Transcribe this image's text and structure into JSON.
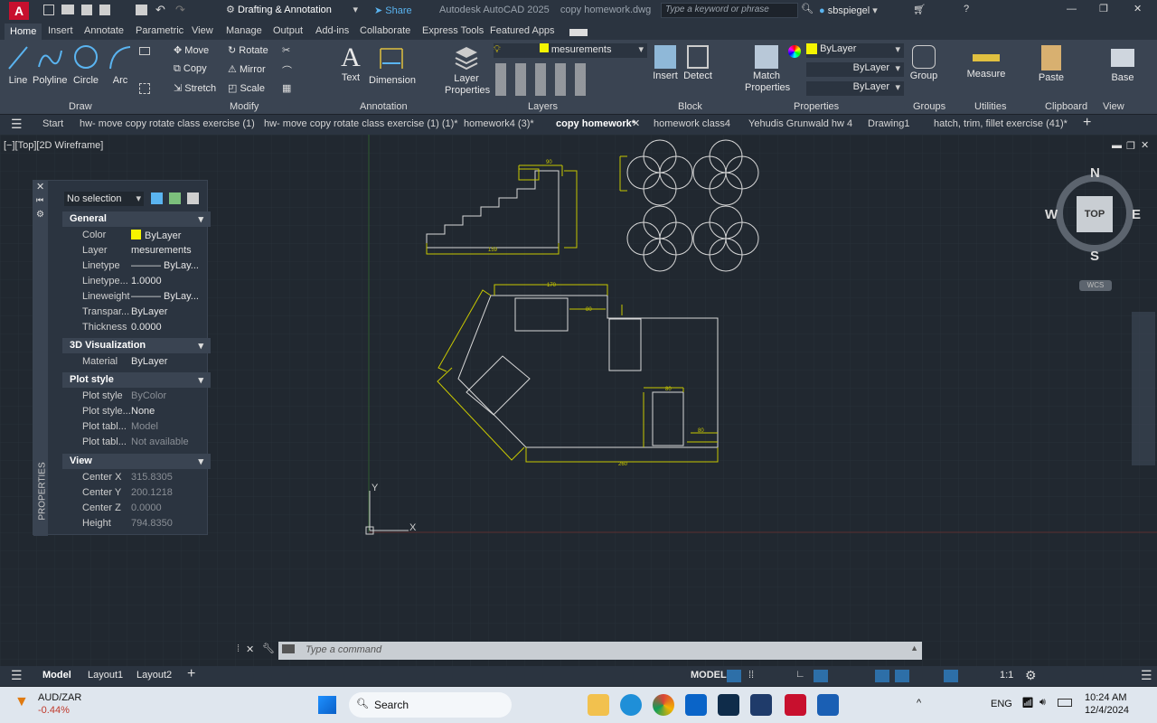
{
  "titlebar": {
    "workspace": "Drafting & Annotation",
    "share": "Share",
    "app_title": "Autodesk AutoCAD 2025    copy homework.dwg",
    "search_placeholder": "Type a keyword or phrase",
    "user": "sbspiegel"
  },
  "ribbon_tabs": [
    "Home",
    "Insert",
    "Annotate",
    "Parametric",
    "View",
    "Manage",
    "Output",
    "Add-ins",
    "Collaborate",
    "Express Tools",
    "Featured Apps"
  ],
  "ribbon": {
    "draw": {
      "line": "Line",
      "polyline": "Polyline",
      "circle": "Circle",
      "arc": "Arc",
      "title": "Draw"
    },
    "modify": {
      "move": "Move",
      "rotate": "Rotate",
      "copy": "Copy",
      "mirror": "Mirror",
      "stretch": "Stretch",
      "scale": "Scale",
      "title": "Modify"
    },
    "annotation": {
      "text": "Text",
      "dimension": "Dimension",
      "title": "Annotation"
    },
    "layers": {
      "layer_properties": "Layer Properties",
      "current_layer": "mesurements",
      "title": "Layers"
    },
    "block": {
      "insert": "Insert",
      "detect": "Detect",
      "title": "Block"
    },
    "properties": {
      "match": "Match Properties",
      "color": "ByLayer",
      "linetype": "ByLayer",
      "lineweight": "ByLayer",
      "title": "Properties"
    },
    "groups": {
      "group": "Group",
      "title": "Groups"
    },
    "utilities": {
      "measure": "Measure",
      "title": "Utilities"
    },
    "clipboard": {
      "paste": "Paste",
      "title": "Clipboard"
    },
    "view": {
      "base": "Base",
      "title": "View"
    }
  },
  "doc_tabs": [
    "Start",
    "hw- move copy rotate class exercise (1)",
    "hw- move copy rotate class exercise (1) (1)*",
    "homework4 (3)*",
    "copy homework*",
    "homework class4",
    "Yehudis Grunwald hw 4",
    "Drawing1",
    "hatch, trim, fillet exercise (41)*"
  ],
  "viewport_label": "[−][Top][2D Wireframe]",
  "properties_panel": {
    "selection": "No selection",
    "side_label": "PROPERTIES",
    "general_title": "General",
    "general": [
      {
        "k": "Color",
        "v": "ByLayer"
      },
      {
        "k": "Layer",
        "v": "mesurements"
      },
      {
        "k": "Linetype",
        "v": "——— ByLay..."
      },
      {
        "k": "Linetype...",
        "v": "1.0000"
      },
      {
        "k": "Lineweight",
        "v": "——— ByLay..."
      },
      {
        "k": "Transpar...",
        "v": "ByLayer"
      },
      {
        "k": "Thickness",
        "v": "0.0000"
      }
    ],
    "viz_title": "3D Visualization",
    "viz": [
      {
        "k": "Material",
        "v": "ByLayer"
      }
    ],
    "plot_title": "Plot style",
    "plot": [
      {
        "k": "Plot style",
        "v": "ByColor"
      },
      {
        "k": "Plot style...",
        "v": "None"
      },
      {
        "k": "Plot tabl...",
        "v": "Model"
      },
      {
        "k": "Plot tabl...",
        "v": "Not available"
      }
    ],
    "view_title": "View",
    "view": [
      {
        "k": "Center X",
        "v": "315.8305"
      },
      {
        "k": "Center Y",
        "v": "200.1218"
      },
      {
        "k": "Center Z",
        "v": "0.0000"
      },
      {
        "k": "Height",
        "v": "794.8350"
      }
    ]
  },
  "viewcube": {
    "n": "N",
    "s": "S",
    "e": "E",
    "w": "W",
    "top": "TOP",
    "wcs": "WCS"
  },
  "ucs": {
    "x": "X",
    "y": "Y"
  },
  "dims": {
    "stair_top": "90",
    "stair_bottom": "159",
    "room_top": "170",
    "room_bottom": "260",
    "room_inner": "80",
    "room_right": "80",
    "room_inner2": "80"
  },
  "command": {
    "placeholder": "Type a command"
  },
  "status": {
    "model_tab": "Model",
    "layout1": "Layout1",
    "layout2": "Layout2",
    "model_btn": "MODEL",
    "scale": "1:1"
  },
  "taskbar": {
    "ticker": "AUD/ZAR",
    "change": "-0.44%",
    "search": "Search",
    "lang": "ENG",
    "time": "10:24 AM",
    "date": "12/4/2024"
  },
  "colors": {
    "accent": "#0696d7",
    "dim_yellow": "#d4d400",
    "geometry": "#d8d8d8",
    "grid": "#2a323c"
  }
}
